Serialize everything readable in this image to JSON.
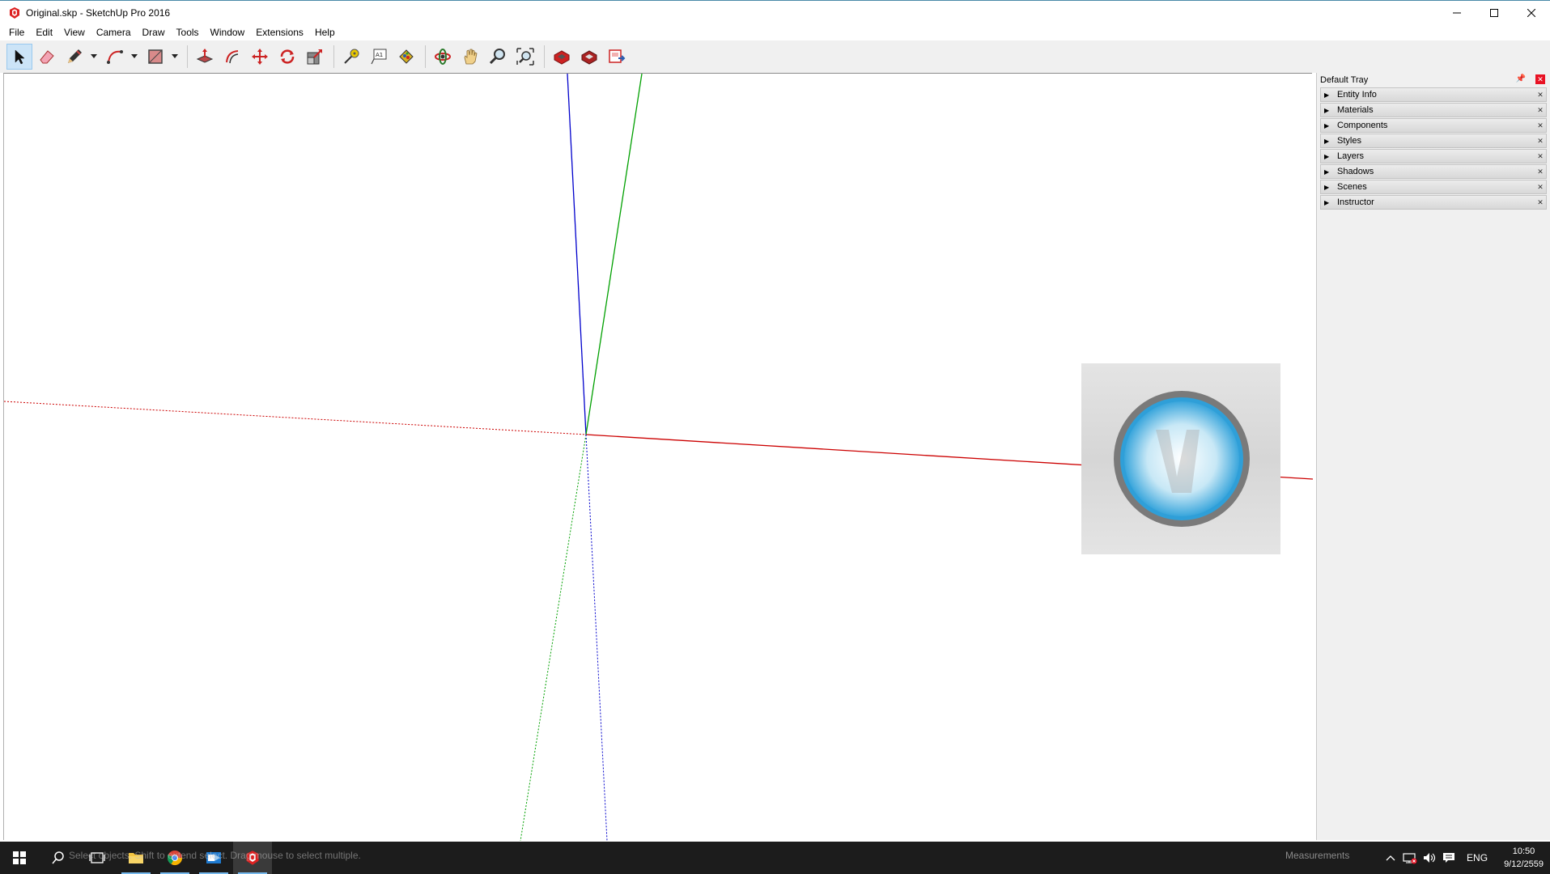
{
  "window": {
    "title": "Original.skp - SketchUp Pro 2016",
    "controls": [
      "minimize-icon",
      "maximize-icon",
      "close-icon"
    ]
  },
  "menu": [
    "File",
    "Edit",
    "View",
    "Camera",
    "Draw",
    "Tools",
    "Window",
    "Extensions",
    "Help"
  ],
  "toolbar": {
    "tools": [
      {
        "name": "select-tool",
        "icon": "arrow-cursor-icon",
        "selected": true
      },
      {
        "name": "eraser-tool",
        "icon": "eraser-icon"
      },
      {
        "name": "line-tool",
        "icon": "pencil-icon",
        "dropdown": true
      },
      {
        "name": "arc-tool",
        "icon": "arc-icon",
        "dropdown": true
      },
      {
        "name": "rectangle-tool",
        "icon": "rectangle-icon",
        "dropdown": true
      },
      {
        "name": "push-pull-tool",
        "icon": "push-pull-icon"
      },
      {
        "name": "offset-tool",
        "icon": "offset-icon"
      },
      {
        "name": "move-tool",
        "icon": "move-icon"
      },
      {
        "name": "rotate-tool",
        "icon": "rotate-icon"
      },
      {
        "name": "scale-tool",
        "icon": "scale-icon"
      },
      {
        "name": "tape-measure-tool",
        "icon": "tape-measure-icon"
      },
      {
        "name": "text-tool",
        "icon": "text-icon"
      },
      {
        "name": "paint-bucket-tool",
        "icon": "paint-bucket-icon"
      },
      {
        "name": "orbit-tool",
        "icon": "orbit-icon"
      },
      {
        "name": "pan-tool",
        "icon": "hand-icon"
      },
      {
        "name": "zoom-tool",
        "icon": "magnifier-icon"
      },
      {
        "name": "zoom-extents-tool",
        "icon": "zoom-extents-icon"
      },
      {
        "name": "warehouse-tool",
        "icon": "warehouse-icon"
      },
      {
        "name": "extension-warehouse-tool",
        "icon": "extension-warehouse-icon"
      },
      {
        "name": "send-to-layout-tool",
        "icon": "layout-icon"
      }
    ]
  },
  "tray": {
    "title": "Default Tray",
    "panels": [
      "Entity Info",
      "Materials",
      "Components",
      "Styles",
      "Layers",
      "Shadows",
      "Scenes",
      "Instructor"
    ]
  },
  "status": {
    "hint": "Select objects. Shift to extend select. Drag mouse to select multiple.",
    "measurements_label": "Measurements"
  },
  "taskbar": {
    "language": "ENG",
    "time": "10:50",
    "date": "9/12/2559"
  },
  "colors": {
    "red_axis": "#cc0000",
    "green_axis": "#00a000",
    "blue_axis": "#0000cc",
    "selected_tool": "#cce4f7",
    "taskbar": "#1c1c1c"
  }
}
